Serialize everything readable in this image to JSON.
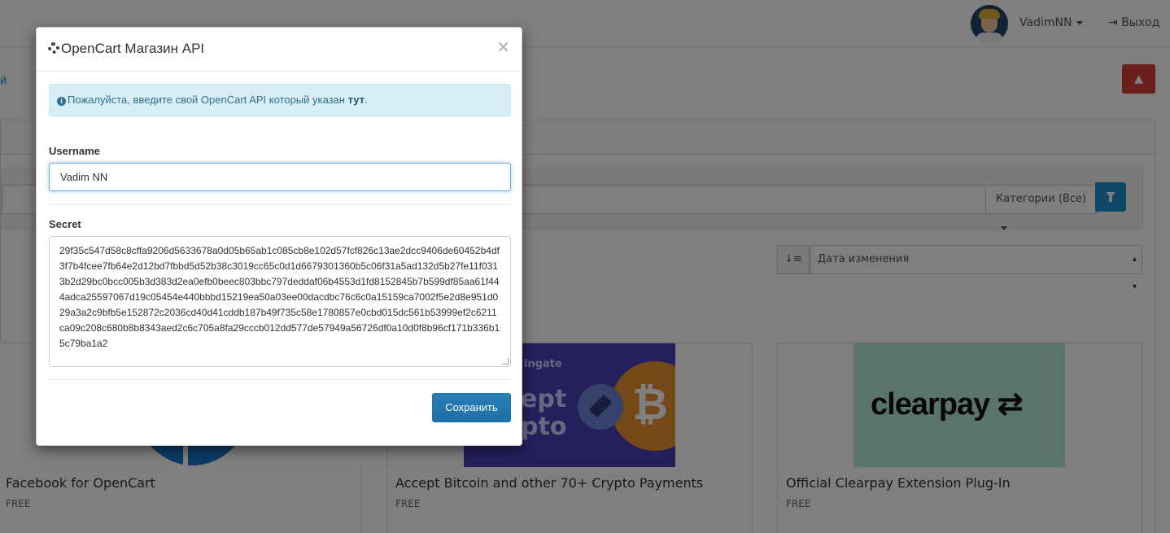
{
  "header": {
    "user_name": "VadimNN",
    "logout_label": "Выход"
  },
  "page": {
    "left_link": "й",
    "alert_icon": "warning-icon",
    "category_filter_label": "Категории (Все)",
    "sort_select_value": "Дата изменения"
  },
  "extensions": [
    {
      "title": "Facebook for OpenCart",
      "price": "FREE"
    },
    {
      "title": "Accept Bitcoin and other 70+ Crypto Payments",
      "price": "FREE",
      "thumb_small": "ingate",
      "thumb_big_line1": "ept",
      "thumb_big_line2": "pto"
    },
    {
      "title": "Official Clearpay Extension Plug-In",
      "price": "FREE",
      "thumb_logo": "clearpay"
    }
  ],
  "modal": {
    "title": "OpenCart Магазин API",
    "close_label": "×",
    "info_text": "Пожалуйста, введите свой OpenCart API который указан ",
    "info_link": "тут",
    "info_end": ".",
    "username_label": "Username",
    "username_value": "Vadim NN",
    "secret_label": "Secret",
    "secret_value": "29f35c547d58c8cffa9206d5633678a0d05b65ab1c085cb8e102d57fcf826c13ae2dcc9406de60452b4df3f7b4fcee7fb64e2d12bd7fbbd5d52b38c3019cc65c0d1d6679301360b5c06f31a5ad132d5b27fe11f0313b2d29bc0bcc005b3d383d2ea0efb0beec803bbc797deddaf06b4553d1fd8152845b7b599df85aa61f444adca25597067d19c05454e440bbbd15219ea50a03ee00dacdbc76c6c0a15159ca7002f5e2d8e951d029a3a2c9bfb5e152872c2036cd40d41cddb187b49f735c58e1780857e0cbd015dc561b53999ef2c6211ca09c208c680b8b8343aed2c6c705a8fa29cccb012dd577de57949a56726df0a10d0f8b96cf171b336b15c79ba1a2",
    "save_label": "Сохранить"
  }
}
